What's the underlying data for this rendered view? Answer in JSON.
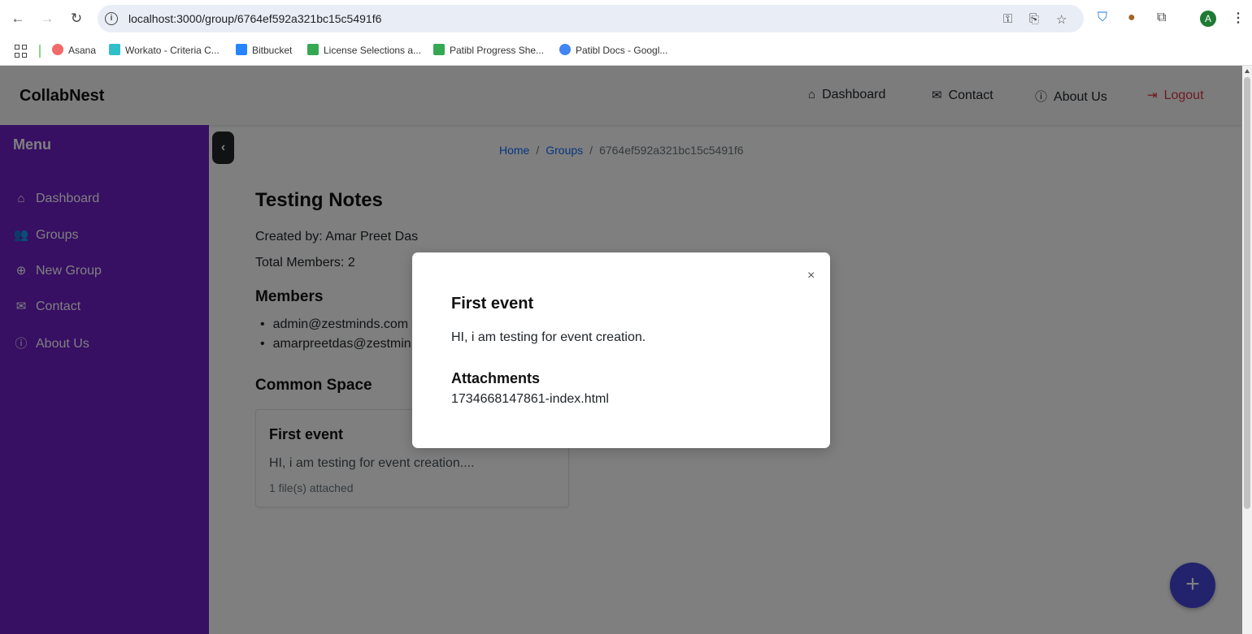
{
  "browser": {
    "url": "localhost:3000/group/6764ef592a321bc15c5491f6",
    "bookmarks": [
      {
        "label": "Asana",
        "color": "#f06a6a"
      },
      {
        "label": "Workato - Criteria C...",
        "color": "#31c0c8"
      },
      {
        "label": "Bitbucket",
        "color": "#2684ff"
      },
      {
        "label": "License Selections a...",
        "color": "#34a853"
      },
      {
        "label": "Patibl Progress She...",
        "color": "#34a853"
      },
      {
        "label": "Patibl Docs - Googl...",
        "color": "#4285f4"
      }
    ],
    "profile_initial": "A"
  },
  "header": {
    "brand": "CollabNest",
    "nav": {
      "dashboard": "Dashboard",
      "contact": "Contact",
      "about": "About Us",
      "logout": "Logout"
    }
  },
  "sidebar": {
    "title": "Menu",
    "items": [
      "Dashboard",
      "Groups",
      "New Group",
      "Contact",
      "About Us"
    ]
  },
  "breadcrumb": {
    "home": "Home",
    "groups": "Groups",
    "current": "6764ef592a321bc15c5491f6",
    "separator": "/"
  },
  "group": {
    "title": "Testing Notes",
    "created_by": "Created by: Amar Preet Das",
    "total_members": "Total Members: 2",
    "members_heading": "Members",
    "members": [
      "admin@zestminds.com",
      "amarpreetdas@zestmin"
    ],
    "common_space_heading": "Common Space"
  },
  "event_card": {
    "title": "First event",
    "description": "HI, i am testing for event creation....",
    "files": "1 file(s) attached"
  },
  "modal": {
    "close": "×",
    "title": "First event",
    "description": "HI, i am testing for event creation.",
    "attachments_heading": "Attachments",
    "attachment": "1734668147861-index.html"
  },
  "fab": {
    "label": "+"
  },
  "colors": {
    "sidebar": "#6f1fc6",
    "fab": "#4547d8",
    "logout": "#dc3545",
    "link": "#0d6efd"
  },
  "icons": [
    "home-icon",
    "envelope-icon",
    "info-icon",
    "logout-icon",
    "users-icon",
    "plus-circle-icon",
    "chevron-left-icon"
  ]
}
